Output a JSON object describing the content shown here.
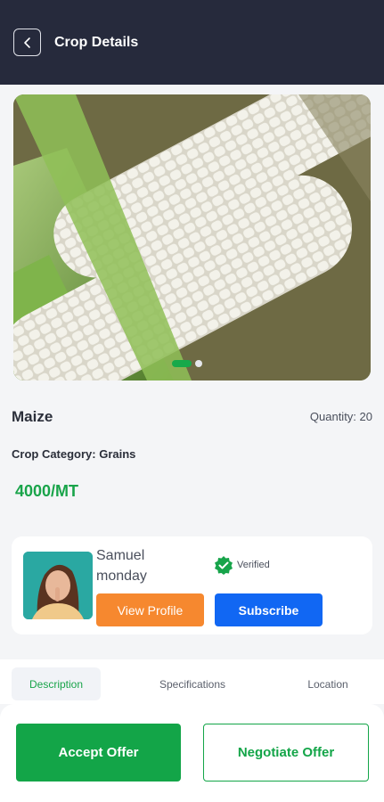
{
  "header": {
    "title": "Crop Details",
    "back_icon": "chevron-left-icon"
  },
  "hero": {
    "subject": "maize-cobs-photo",
    "carousel_pages": 2,
    "carousel_active": 1
  },
  "crop": {
    "name": "Maize",
    "quantity": "Quantity: 20",
    "category": "Crop Category: Grains",
    "price": "4000/MT"
  },
  "seller": {
    "name": "Samuel monday",
    "verified_label": "Verified",
    "view_profile_label": "View Profile",
    "subscribe_label": "Subscribe"
  },
  "tabs": [
    {
      "label": "Description",
      "active": true
    },
    {
      "label": "Specifications",
      "active": false
    },
    {
      "label": "Location",
      "active": false
    }
  ],
  "actions": {
    "accept_label": "Accept Offer",
    "negotiate_label": "Negotiate Offer"
  },
  "colors": {
    "header_bg": "#262a3c",
    "green": "#13a548",
    "orange": "#f6882f",
    "blue": "#1167f3"
  }
}
